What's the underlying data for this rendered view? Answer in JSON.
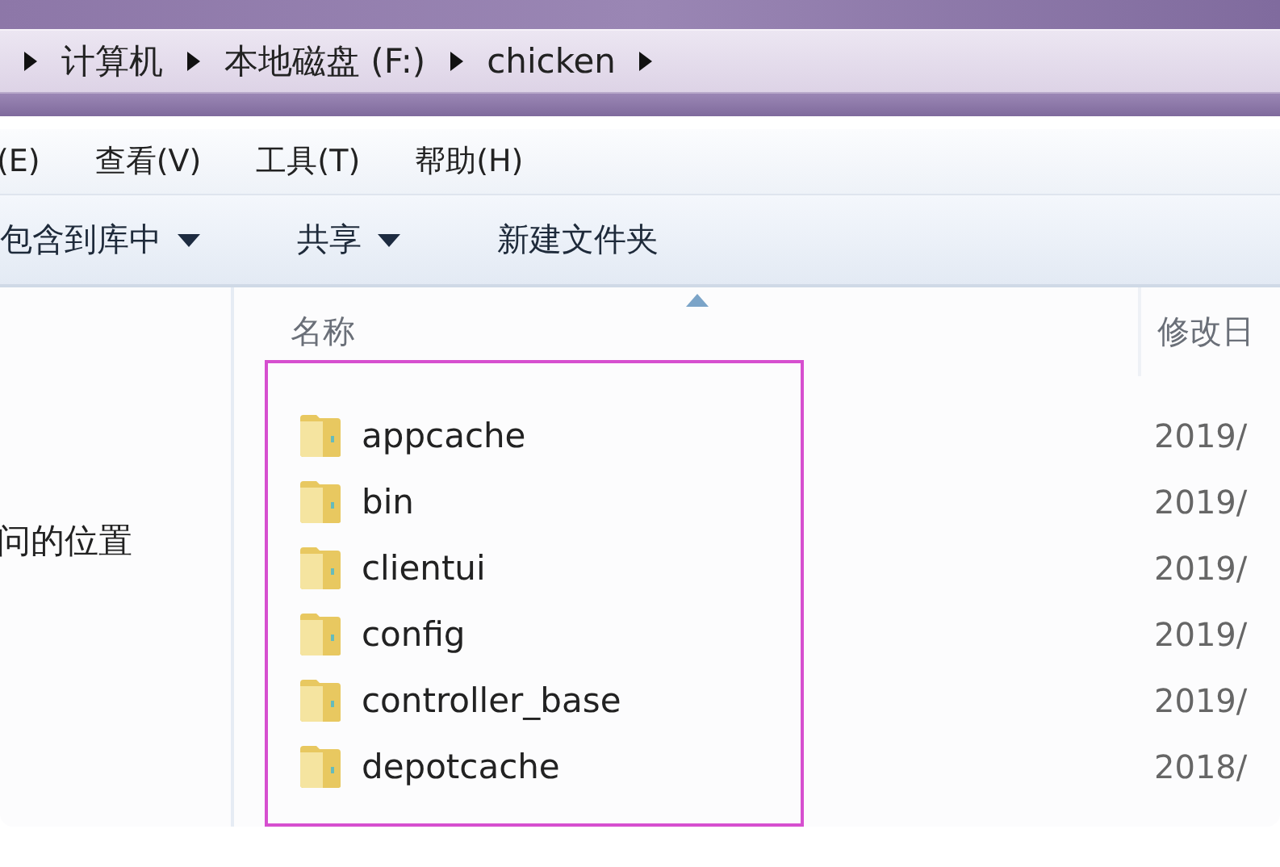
{
  "address_bar": {
    "segments": [
      "计算机",
      "本地磁盘 (F:)",
      "chicken"
    ]
  },
  "menu_bar": {
    "items": [
      "(E)",
      "查看(V)",
      "工具(T)",
      "帮助(H)"
    ]
  },
  "toolbar": {
    "items": [
      {
        "label": "包含到库中",
        "dropdown": true
      },
      {
        "label": "共享",
        "dropdown": true
      },
      {
        "label": "新建文件夹",
        "dropdown": false
      }
    ]
  },
  "navigation_pane": {
    "items": [
      "问的位置"
    ]
  },
  "file_list": {
    "columns": [
      {
        "label": "名称",
        "sorted": true
      },
      {
        "label": "修改日",
        "sorted": false
      }
    ],
    "rows": [
      {
        "name": "appcache",
        "modified": "2019/"
      },
      {
        "name": "bin",
        "modified": "2019/"
      },
      {
        "name": "clientui",
        "modified": "2019/"
      },
      {
        "name": "config",
        "modified": "2019/"
      },
      {
        "name": "controller_base",
        "modified": "2019/"
      },
      {
        "name": "depotcache",
        "modified": "2018/"
      }
    ]
  }
}
